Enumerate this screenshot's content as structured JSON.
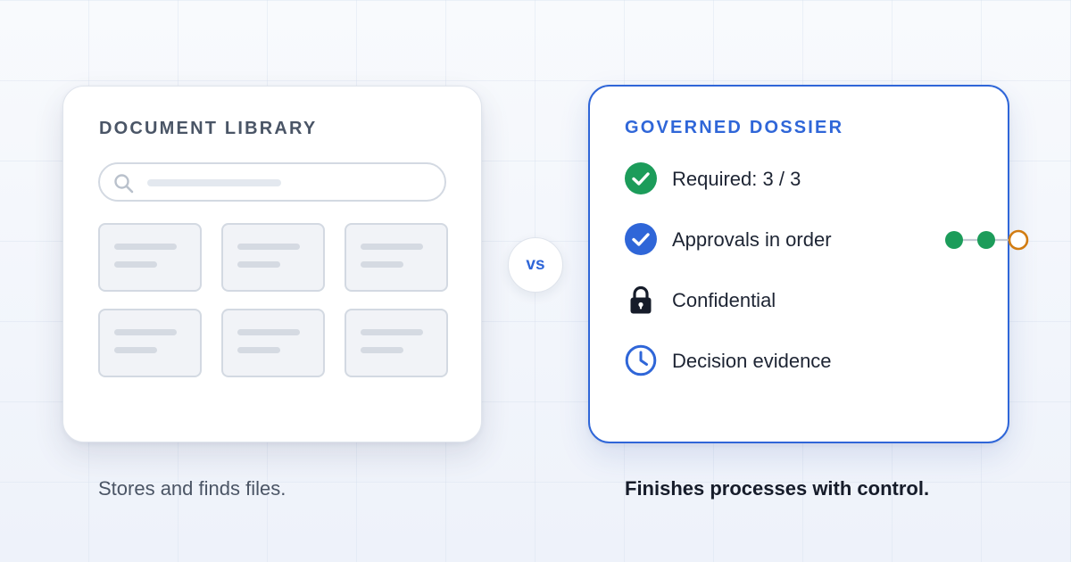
{
  "left_card": {
    "title": "DOCUMENT LIBRARY",
    "search_icon": "search-icon",
    "tile_count": 6,
    "caption": "Stores and finds files."
  },
  "divider": {
    "label": "vs"
  },
  "right_card": {
    "title": "GOVERNED DOSSIER",
    "items": [
      {
        "label": "Required: 3 / 3",
        "icon": "check-circle-icon",
        "icon_color": "#1c9c5a"
      },
      {
        "label": "Approvals in order",
        "icon": "check-circle-icon",
        "icon_color": "#2f66d8"
      },
      {
        "label": "Confidential",
        "icon": "lock-icon",
        "icon_color": "#161c2a"
      },
      {
        "label": "Decision evidence",
        "icon": "clock-icon",
        "icon_color": "#2f66d8"
      }
    ],
    "approval_progress": {
      "steps": [
        "complete",
        "complete",
        "pending"
      ],
      "complete_color": "#1c9c5a",
      "pending_color": "#d17c12"
    },
    "caption": "Finishes processes with control."
  },
  "colors": {
    "accent": "#2f66d8",
    "success": "#1c9c5a",
    "warning": "#d17c12",
    "muted_text": "#4b5565"
  }
}
